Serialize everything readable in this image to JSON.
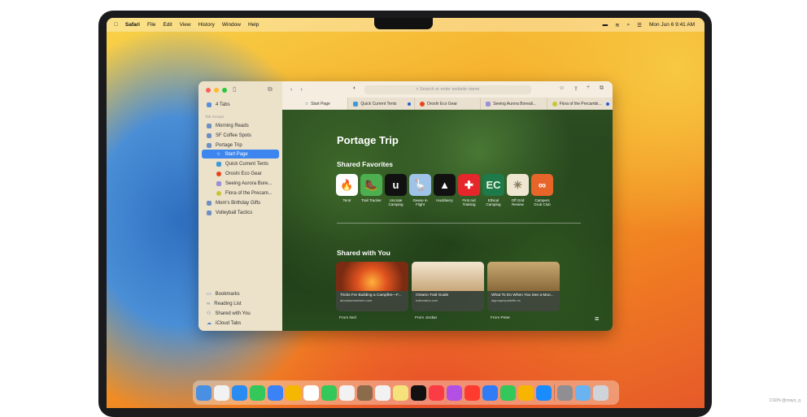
{
  "menubar": {
    "app": "Safari",
    "items": [
      "File",
      "Edit",
      "View",
      "History",
      "Window",
      "Help"
    ],
    "clock": "Mon Jun 6  9:41 AM"
  },
  "sidebar": {
    "all_tabs": "4 Tabs",
    "section": "Tab Groups",
    "groups": [
      "Morning Reads",
      "SF Coffee Spots",
      "Portage Trip"
    ],
    "portage_tabs": [
      "Start Page",
      "Quick Current Tents",
      "Oroshi Eco Gear",
      "Seeing Aurora Bore...",
      "Flora of the Precam..."
    ],
    "groups_after": [
      "Mom's Birthday Gifts",
      "Volleyball Tactics"
    ],
    "bottom": [
      "Bookmarks",
      "Reading List",
      "Shared with You",
      "iCloud Tabs"
    ]
  },
  "toolbar": {
    "search_placeholder": "Search or enter website name"
  },
  "tabs": [
    "Start Page",
    "Quick Current Tents",
    "Oroshi Eco Gear",
    "Seeing Aurora Boreali...",
    "Flora of the Precambi..."
  ],
  "page": {
    "title": "Portage Trip",
    "favorites_heading": "Shared Favorites",
    "favorites": [
      {
        "label": "Tentr",
        "glyph": "🔥",
        "bg": "#ffffff",
        "fg": "#e8542a"
      },
      {
        "label": "Trail Tracker",
        "glyph": "🥾",
        "bg": "#4caf50",
        "fg": "#fff"
      },
      {
        "label": "Uncrate Camping",
        "glyph": "u",
        "bg": "#111111",
        "fg": "#fff"
      },
      {
        "label": "Geese in Flight",
        "glyph": "🪿",
        "bg": "#9ec3e6",
        "fg": "#333"
      },
      {
        "label": "Huckberry",
        "glyph": "▲",
        "bg": "#111111",
        "fg": "#fff"
      },
      {
        "label": "First Aid Training",
        "glyph": "✚",
        "bg": "#e5262b",
        "fg": "#fff"
      },
      {
        "label": "Ethical Camping",
        "glyph": "EC",
        "bg": "#1f7a4a",
        "fg": "#e8f5e0"
      },
      {
        "label": "Off Grid Review",
        "glyph": "✳",
        "bg": "#efe6d2",
        "fg": "#8a7a5a"
      },
      {
        "label": "Campers Grub Club",
        "glyph": "∞",
        "bg": "#e8652a",
        "fg": "#fff"
      }
    ],
    "shared_heading": "Shared with You",
    "shared": [
      {
        "title": "Tricks For Building a Campfire—F...",
        "url": "aboutsomewhere.com",
        "from": "From Neil"
      },
      {
        "title": "Ontario Trail Guide",
        "url": "trailontario.com",
        "from": "From Jordan"
      },
      {
        "title": "What To Do When You See a Moo...",
        "url": "algonquinparklife.ca",
        "from": "From Peter"
      }
    ]
  },
  "dock_colors": [
    "#4a90e2",
    "#f2f2f2",
    "#2a8cf0",
    "#34c759",
    "#3b82f6",
    "#f5b700",
    "#ffffff",
    "#34c759",
    "#f2f2f2",
    "#8b6b4a",
    "#f2f2f2",
    "#f5e27a",
    "#111111",
    "#fc3c44",
    "#b150e2",
    "#ff3b30",
    "#2f7cf6",
    "#34c759",
    "#f7b500",
    "#1a8cff",
    "#8e8e93",
    "#6bb3f0",
    "#cfd4da"
  ],
  "watermark": "CSDN @mayo_q"
}
